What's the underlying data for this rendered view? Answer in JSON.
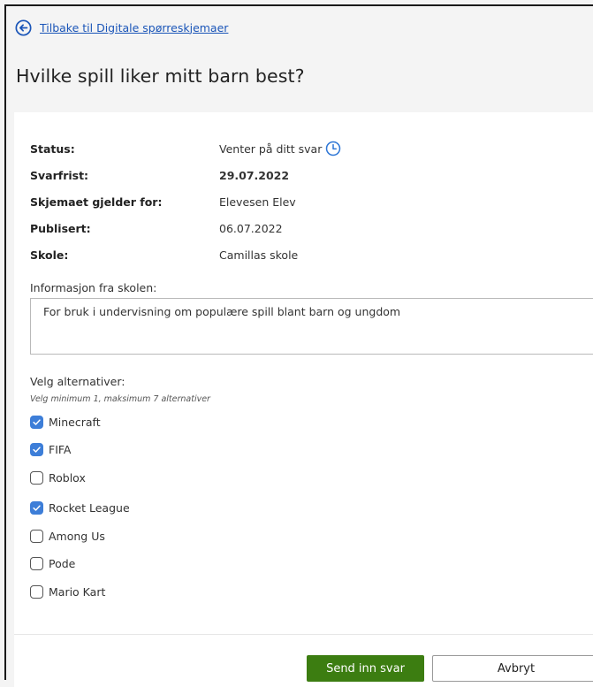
{
  "back_link": {
    "label": "Tilbake til Digitale spørreskjemaer"
  },
  "page_title": "Hvilke spill liker mitt barn best?",
  "meta": [
    {
      "label": "Status:",
      "value": "Venter på ditt svar"
    },
    {
      "label": "Svarfrist:",
      "value": "29.07.2022"
    },
    {
      "label": "Skjemaet gjelder for:",
      "value": "Elevesen Elev"
    },
    {
      "label": "Publisert:",
      "value": "06.07.2022"
    },
    {
      "label": "Skole:",
      "value": "Camillas skole"
    }
  ],
  "info": {
    "label": "Informasjon fra skolen:",
    "text": "For bruk i undervisning om populære spill blant barn og ungdom"
  },
  "choices": {
    "label": "Velg alternativer:",
    "hint": "Velg minimum 1, maksimum 7 alternativer",
    "options": [
      {
        "label": "Minecraft",
        "checked": true
      },
      {
        "label": "FIFA",
        "checked": true
      },
      {
        "label": "Roblox",
        "checked": false
      },
      {
        "label": "Rocket League",
        "checked": true
      },
      {
        "label": "Among Us",
        "checked": false
      },
      {
        "label": "Pode",
        "checked": false
      },
      {
        "label": "Mario Kart",
        "checked": false
      }
    ]
  },
  "buttons": {
    "submit": "Send inn svar",
    "cancel": "Avbryt"
  },
  "colors": {
    "link": "#1a55b8",
    "accent": "#3d7ed8",
    "submit": "#3c7d11"
  }
}
